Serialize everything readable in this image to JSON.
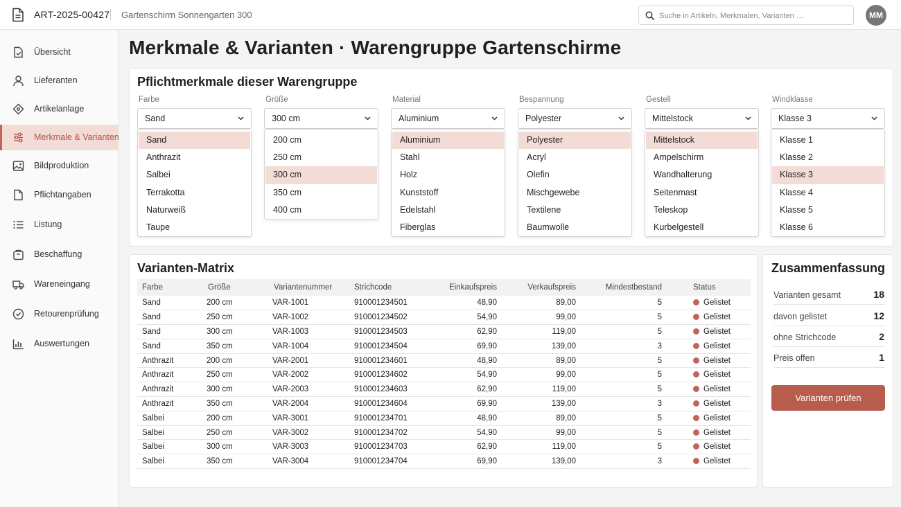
{
  "header": {
    "article_id": "ART-2025-00427",
    "product_name": "Gartenschirm Sonnengarten 300",
    "search_placeholder": "Suche in Artikeln, Merkmalen, Varianten …",
    "avatar_initials": "MM",
    "icons": {
      "document": "document-icon",
      "search": "search-icon"
    }
  },
  "sidebar": {
    "items": [
      {
        "label": "Übersicht",
        "icon": "overview-icon",
        "active": false
      },
      {
        "label": "Lieferanten",
        "icon": "supplier-icon",
        "active": false
      },
      {
        "label": "Artikelanlage",
        "icon": "tag-icon",
        "active": false
      },
      {
        "label": "Merkmale & Varianten",
        "icon": "sliders-icon",
        "active": true
      },
      {
        "label": "Bildproduktion",
        "icon": "image-icon",
        "active": false
      },
      {
        "label": "Pflichtangaben",
        "icon": "file-icon",
        "active": false
      },
      {
        "label": "Listung",
        "icon": "list-icon",
        "active": false
      },
      {
        "label": "Beschaffung",
        "icon": "package-icon",
        "active": false
      },
      {
        "label": "Wareneingang",
        "icon": "truck-icon",
        "active": false
      },
      {
        "label": "Retourenprüfung",
        "icon": "check-circle-icon",
        "active": false
      },
      {
        "label": "Auswertungen",
        "icon": "bar-chart-icon",
        "active": false
      }
    ]
  },
  "page": {
    "title": "Merkmale & Varianten · Warengruppe Gartenschirme"
  },
  "attributes": {
    "title": "Pflichtmerkmale dieser Warengruppe",
    "fields": [
      {
        "label": "Farbe",
        "value": "Sand",
        "options": [
          "Sand",
          "Anthrazit",
          "Salbei",
          "Terrakotta",
          "Naturweiß",
          "Taupe"
        ]
      },
      {
        "label": "Größe",
        "value": "300 cm",
        "options": [
          "200 cm",
          "250 cm",
          "300 cm",
          "350 cm",
          "400 cm"
        ]
      },
      {
        "label": "Material",
        "value": "Aluminium",
        "options": [
          "Aluminium",
          "Stahl",
          "Holz",
          "Kunststoff",
          "Edelstahl",
          "Fiberglas"
        ]
      },
      {
        "label": "Bespannung",
        "value": "Polyester",
        "options": [
          "Polyester",
          "Acryl",
          "Olefin",
          "Mischgewebe",
          "Textilene",
          "Baumwolle"
        ]
      },
      {
        "label": "Gestell",
        "value": "Mittelstock",
        "options": [
          "Mittelstock",
          "Ampelschirm",
          "Wandhalterung",
          "Seitenmast",
          "Teleskop",
          "Kurbelgestell"
        ]
      },
      {
        "label": "Windklasse",
        "value": "Klasse 3",
        "options": [
          "Klasse 1",
          "Klasse 2",
          "Klasse 3",
          "Klasse 4",
          "Klasse 5",
          "Klasse 6"
        ]
      }
    ]
  },
  "matrix": {
    "title": "Varianten-Matrix",
    "columns": [
      "Farbe",
      "Größe",
      "Variantenummer",
      "Strichcode",
      "Einkaufspreis",
      "Verkaufspreis",
      "Mindestbestand",
      "Status"
    ],
    "rows": [
      [
        "Sand",
        "200 cm",
        "VAR-1001",
        "910001234501",
        "48,90",
        "89,00",
        "5",
        "Gelistet"
      ],
      [
        "Sand",
        "250 cm",
        "VAR-1002",
        "910001234502",
        "54,90",
        "99,00",
        "5",
        "Gelistet"
      ],
      [
        "Sand",
        "300 cm",
        "VAR-1003",
        "910001234503",
        "62,90",
        "119,00",
        "5",
        "Gelistet"
      ],
      [
        "Sand",
        "350 cm",
        "VAR-1004",
        "910001234504",
        "69,90",
        "139,00",
        "3",
        "Gelistet"
      ],
      [
        "Anthrazit",
        "200 cm",
        "VAR-2001",
        "910001234601",
        "48,90",
        "89,00",
        "5",
        "Gelistet"
      ],
      [
        "Anthrazit",
        "250 cm",
        "VAR-2002",
        "910001234602",
        "54,90",
        "99,00",
        "5",
        "Gelistet"
      ],
      [
        "Anthrazit",
        "300 cm",
        "VAR-2003",
        "910001234603",
        "62,90",
        "119,00",
        "5",
        "Gelistet"
      ],
      [
        "Anthrazit",
        "350 cm",
        "VAR-2004",
        "910001234604",
        "69,90",
        "139,00",
        "3",
        "Gelistet"
      ],
      [
        "Salbei",
        "200 cm",
        "VAR-3001",
        "910001234701",
        "48,90",
        "89,00",
        "5",
        "Gelistet"
      ],
      [
        "Salbei",
        "250 cm",
        "VAR-3002",
        "910001234702",
        "54,90",
        "99,00",
        "5",
        "Gelistet"
      ],
      [
        "Salbei",
        "300 cm",
        "VAR-3003",
        "910001234703",
        "62,90",
        "119,00",
        "5",
        "Gelistet"
      ],
      [
        "Salbei",
        "350 cm",
        "VAR-3004",
        "910001234704",
        "69,90",
        "139,00",
        "3",
        "Gelistet"
      ]
    ]
  },
  "summary": {
    "title": "Zusammenfassung",
    "items": [
      {
        "label": "Varianten gesamt",
        "value": "18"
      },
      {
        "label": "davon gelistet",
        "value": "12"
      },
      {
        "label": "ohne Strichcode",
        "value": "2"
      },
      {
        "label": "Preis offen",
        "value": "1"
      }
    ],
    "button_label": "Varianten prüfen"
  },
  "colors": {
    "accent": "#c0655a",
    "accent_light": "#f3dcd6",
    "status_listed": "#c0655a",
    "button_bg": "#b85c4e"
  }
}
